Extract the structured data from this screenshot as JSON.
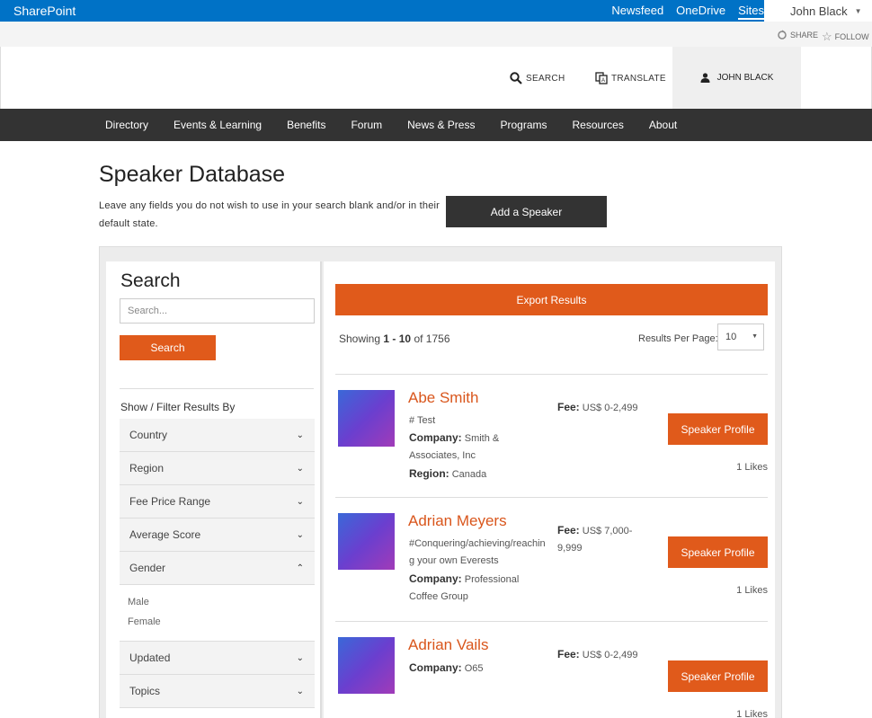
{
  "suitebar": {
    "brand": "SharePoint",
    "links": [
      "Newsfeed",
      "OneDrive",
      "Sites"
    ],
    "user": "John Black"
  },
  "shareline": {
    "share": "SHARE",
    "follow": "FOLLOW"
  },
  "header": {
    "search": "SEARCH",
    "translate": "TRANSLATE",
    "user": "JOHN BLACK"
  },
  "nav": [
    "Directory",
    "Events & Learning",
    "Benefits",
    "Forum",
    "News & Press",
    "Programs",
    "Resources",
    "About"
  ],
  "page": {
    "title": "Speaker Database",
    "intro": "Leave any fields you do not wish to use in your search blank and/or in their default state.",
    "add_button": "Add a Speaker"
  },
  "search": {
    "title": "Search",
    "placeholder": "Search...",
    "button": "Search",
    "filter_heading": "Show / Filter Results By",
    "filters": [
      "Country",
      "Region",
      "Fee Price Range",
      "Average Score",
      "Gender",
      "Updated",
      "Topics"
    ],
    "gender_options": [
      "Male",
      "Female"
    ]
  },
  "results": {
    "export": "Export Results",
    "showing_prefix": "Showing",
    "range_start": "1",
    "range_sep": "-",
    "range_end": "10",
    "of": "of 1756",
    "per_page_label": "Results Per Page:",
    "per_page_value": "10",
    "profile_label": "Speaker Profile",
    "items": [
      {
        "name": "Abe Smith",
        "tag": "# Test",
        "company_label": "Company:",
        "company": "Smith & Associates, Inc",
        "region_label": "Region:",
        "region": "Canada",
        "fee_label": "Fee:",
        "fee": "US$ 0-2,499",
        "likes": "1 Likes"
      },
      {
        "name": "Adrian Meyers",
        "tag": "#Conquering/achieving/reaching your own Everests",
        "company_label": "Company:",
        "company": "Professional Coffee Group",
        "fee_label": "Fee:",
        "fee": "US$ 7,000-9,999",
        "likes": "1 Likes"
      },
      {
        "name": "Adrian Vails",
        "company_label": "Company:",
        "company": "O65",
        "fee_label": "Fee:",
        "fee": "US$ 0-2,499",
        "likes": "1 Likes"
      }
    ]
  }
}
